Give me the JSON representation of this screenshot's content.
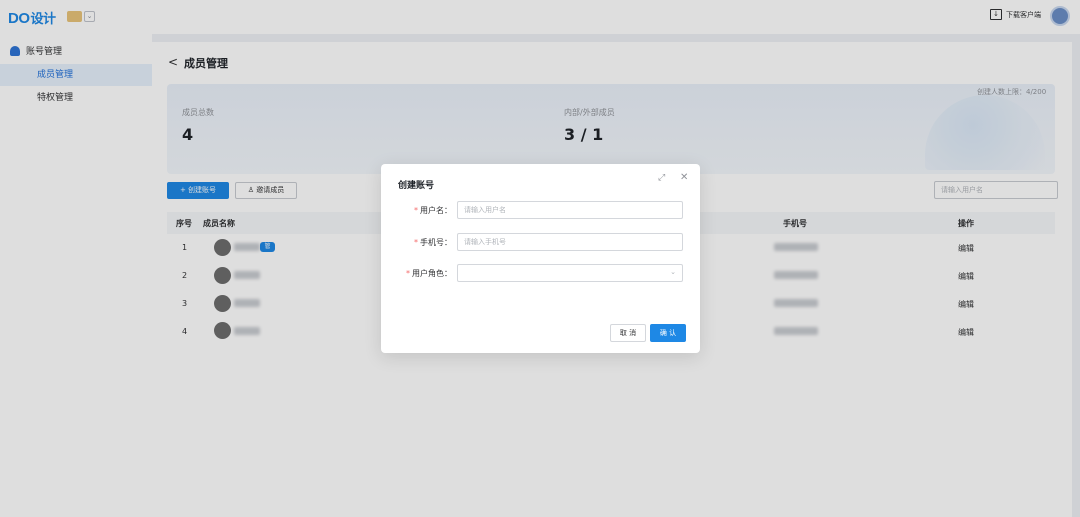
{
  "topbar": {
    "logo_latin": "DO",
    "logo_cn": "设计",
    "download_label": "下载客户端"
  },
  "sidebar": {
    "group_label": "账号管理",
    "items": [
      {
        "label": "成员管理",
        "active": true
      },
      {
        "label": "特权管理",
        "active": false
      }
    ]
  },
  "page": {
    "title": "成员管理",
    "limit_text": "创建人数上限：4/200"
  },
  "stats": {
    "total_label": "成员总数",
    "total_value": "4",
    "internal_external_label": "内部/外部成员",
    "internal_external_value": "3 / 1"
  },
  "toolbar": {
    "create_label": "+ 创建账号",
    "invite_label": "邀请成员",
    "search_placeholder": "请输入用户名"
  },
  "table": {
    "headers": {
      "index": "序号",
      "member_name": "成员名称",
      "phone": "手机号",
      "actions": "操作"
    },
    "owner_badge": "管",
    "rows": [
      {
        "index": "1",
        "action": "编辑"
      },
      {
        "index": "2",
        "action": "编辑"
      },
      {
        "index": "3",
        "action": "编辑"
      },
      {
        "index": "4",
        "action": "编辑"
      }
    ]
  },
  "modal": {
    "title": "创建账号",
    "username_label": "用户名：",
    "username_placeholder": "请输入用户名",
    "phone_label": "手机号：",
    "phone_placeholder": "请输入手机号",
    "role_label": "用户角色：",
    "cancel_label": "取 消",
    "confirm_label": "确 认"
  },
  "colors": {
    "accent": "#1e88e5",
    "required": "#f56c6c",
    "sidebar_active_bg": "#e6f0fc"
  },
  "icons": [
    "user-icon",
    "folder-icon",
    "chevron-down-icon",
    "download-icon",
    "avatar",
    "back-arrow-icon",
    "person-icon",
    "expand-icon",
    "close-icon"
  ]
}
